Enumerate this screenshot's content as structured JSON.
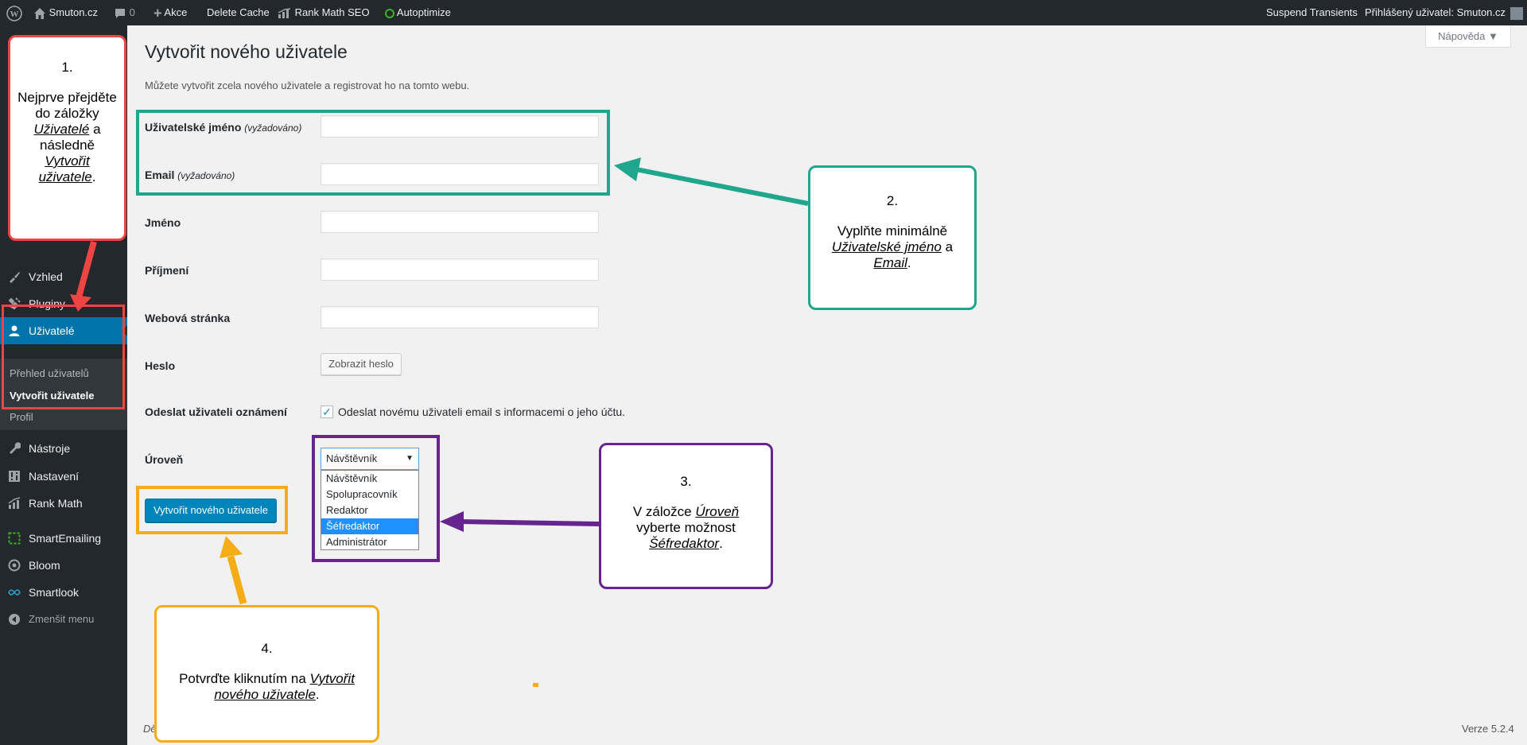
{
  "admin_bar": {
    "site_name": "Smuton.cz",
    "comments_count": "0",
    "new_label": "Akce",
    "delete_cache": "Delete Cache",
    "rank_math": "Rank Math SEO",
    "autoptimize": "Autoptimize",
    "suspend_transients": "Suspend Transients",
    "logged_user": "Přihlášený uživatel: Smuton.cz"
  },
  "sidebar": {
    "items": [
      {
        "label": "Vzhled",
        "icon": "brush-icon"
      },
      {
        "label": "Pluginy",
        "icon": "plugin-icon"
      },
      {
        "label": "Uživatelé",
        "icon": "user-icon"
      },
      {
        "label": "Nástroje",
        "icon": "wrench-icon"
      },
      {
        "label": "Nastavení",
        "icon": "settings-icon"
      },
      {
        "label": "Rank Math",
        "icon": "chart-icon"
      },
      {
        "label": "SmartEmailing",
        "icon": "square-icon"
      },
      {
        "label": "Bloom",
        "icon": "flower-icon"
      },
      {
        "label": "Smartlook",
        "icon": "infinity-icon"
      },
      {
        "label": "Zmenšit menu",
        "icon": "collapse-icon"
      }
    ],
    "submenu": [
      "Přehled uživatelů",
      "Vytvořit uživatele",
      "Profil"
    ]
  },
  "main": {
    "help_label": "Nápověda ▼",
    "title": "Vytvořit nového uživatele",
    "description": "Můžete vytvořit zcela nového uživatele a registrovat ho na tomto webu.",
    "fields": {
      "username_label": "Uživatelské jméno",
      "username_req": "(vyžadováno)",
      "email_label": "Email",
      "email_req": "(vyžadováno)",
      "first_name_label": "Jméno",
      "last_name_label": "Příjmení",
      "website_label": "Webová stránka",
      "password_label": "Heslo",
      "show_password": "Zobrazit heslo",
      "notify_label": "Odeslat uživateli oznámení",
      "notify_text": "Odeslat novému uživateli email s informacemi o jeho účtu.",
      "role_label": "Úroveň",
      "role_selected": "Návštěvník",
      "role_options": [
        "Návštěvník",
        "Spolupracovník",
        "Redaktor",
        "Šéfredaktor",
        "Administrátor"
      ],
      "role_highlighted": "Šéfredaktor"
    },
    "submit_label": "Vytvořit nového uživatele",
    "footer_left": "Dě",
    "footer_right": "Verze 5.2.4"
  },
  "annotations": {
    "step1": {
      "num": "1.",
      "line1": "Nejprve přejděte do záložky",
      "em1": "Uživatelé",
      "mid": "a následně",
      "em2": "Vytvořit uživatele",
      "end": "."
    },
    "step2": {
      "num": "2.",
      "line1": "Vyplňte minimálně",
      "em1": "Uživatelské jméno",
      "mid": "a",
      "em2": "Email",
      "end": "."
    },
    "step3": {
      "num": "3.",
      "line1": "V záložce",
      "em1": "Úroveň",
      "mid": "vyberte možnost",
      "em2": "Šéfredaktor",
      "end": "."
    },
    "step4": {
      "num": "4.",
      "line1": "Potvrďte kliknutím na",
      "em1": "Vytvořit nového uživatele",
      "end": "."
    },
    "colors": {
      "red": "#ee4444",
      "teal": "#1fa68d",
      "purple": "#66248f",
      "orange": "#f5ad16",
      "wp_blue": "#0073aa"
    }
  }
}
